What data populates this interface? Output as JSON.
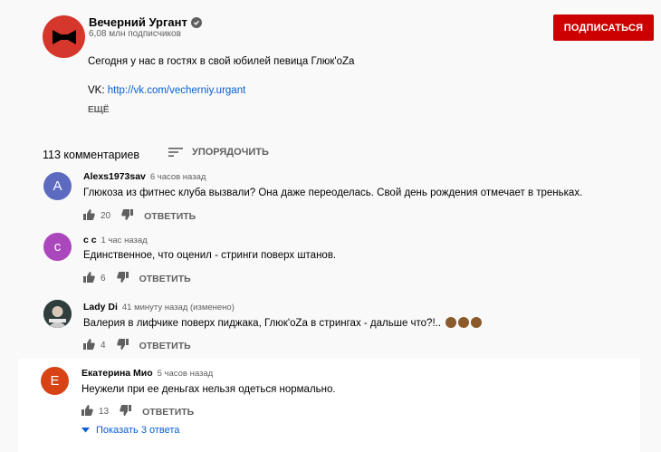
{
  "channel": {
    "name": "Вечерний Ургант",
    "subscribers": "6,08 млн подписчиков",
    "subscribe_label": "ПОДПИСАТЬСЯ"
  },
  "description": {
    "text": "Сегодня у нас в гостях в свой юбилей певица Глюк'oZa",
    "vk_prefix": "VK: ",
    "vk_link": "http://vk.com/vecherniy.urgant",
    "more_label": "ЕЩЁ"
  },
  "comments_header": {
    "count": "113 комментариев",
    "sort_label": "УПОРЯДОЧИТЬ"
  },
  "comments": [
    {
      "initial": "A",
      "author": "Alexs1973sav",
      "time": "6 часов назад",
      "text": "Глюкоза из  фитнес клуба вызвали? Она даже переоделась. Свой день рождения отмечает в треньках.",
      "likes": "20",
      "reply": "ОТВЕТИТЬ",
      "avatar_color": "#5c6bc0"
    },
    {
      "initial": "c",
      "author": "с с",
      "time": "1 час назад",
      "text": "Единственное, что оценил - стринги поверх штанов.",
      "likes": "6",
      "reply": "ОТВЕТИТЬ",
      "avatar_color": "#ab47bc"
    },
    {
      "initial": "",
      "author": "Lady Di",
      "time": "41 минуту назад (изменено)",
      "text": "Валерия в лифчике поверх пиджака, Глюк'oZa в стрингах - дальше что?!..",
      "likes": "4",
      "reply": "ОТВЕТИТЬ",
      "avatar_color": "#3a4a4a"
    },
    {
      "initial": "E",
      "author": "Екатерина Мио",
      "time": "5 часов назад",
      "text": "Неужели при ее деньгах нельзя одеться нормально.",
      "likes": "13",
      "reply": "ОТВЕТИТЬ",
      "avatar_color": "#d84315"
    }
  ],
  "show_replies": "Показать 3 ответа"
}
